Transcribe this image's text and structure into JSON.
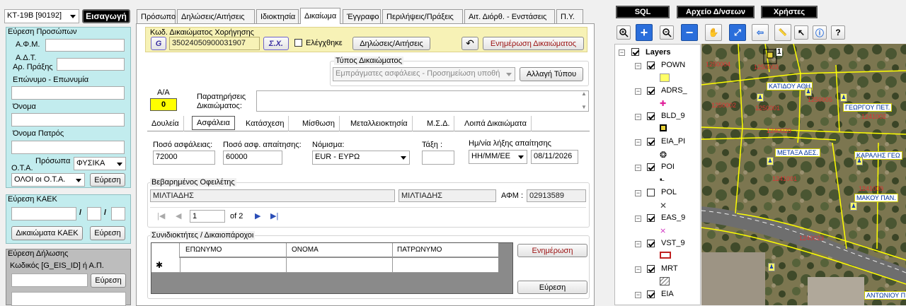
{
  "topbar": {
    "record_id": "ΚΤ-19Β  [90192]",
    "insert_label": "Εισαγωγή"
  },
  "search_persons": {
    "title": "Εύρεση Προσώπων",
    "afm_label": "Α.Φ.Μ.",
    "adt_label": "Α.Δ.Τ.",
    "praxis_label": "Αρ. Πράξης",
    "surname_label": "Επώνυμο - Επωνυμία",
    "name_label": "Όνομα",
    "father_label": "Όνομα Πατρός",
    "persons_label": "Πρόσωπα",
    "persons_value": "ΦΥΣΙΚΑ",
    "ota_label": "Ο.Τ.Α.",
    "ota_value": "ΟΛΟΙ οι Ο.Τ.Α.",
    "search_label": "Εύρεση"
  },
  "search_kaek": {
    "title": "Εύρεση ΚΑΕΚ",
    "slash": "/",
    "rights_label": "Δικαιώματα ΚΑΕΚ",
    "search_label": "Εύρεση"
  },
  "search_decl": {
    "title": "Εύρεση Δήλωσης",
    "code_label": "Κωδικός [G_EIS_ID]  ή  Α.Π.",
    "search_label": "Εύρεση"
  },
  "tabs": [
    {
      "label": "Πρόσωπο"
    },
    {
      "label": "Δηλώσεις/Αιτήσεις"
    },
    {
      "label": "Ιδιοκτησία"
    },
    {
      "label": "Δικαίωμα"
    },
    {
      "label": "Έγγραφο"
    },
    {
      "label": "Περιλήψεις/Πράξεις"
    },
    {
      "label": "Αιτ. Διόρθ. - Ενστάσεις"
    },
    {
      "label": "Π.Υ."
    }
  ],
  "right_header": {
    "code_label": "Κωδ. Δικαιώματος Χορήγησης",
    "g_label": "G",
    "code_value": "35024050900031907",
    "sx_label": "Σ.Χ.",
    "checked_label": "Ελέγχθηκε",
    "decl_label": "Δηλώσεις/Αιτήσεις",
    "update_label": "Ενημέρωση Δικαιώματος"
  },
  "right_type": {
    "title": "Τύπος Δικαιώματος",
    "value": "Εμπράγματες ασφάλειες - Προσημείωση υποθή",
    "change_label": "Αλλαγή Τύπου"
  },
  "aa": {
    "label": "Α/Α",
    "value": "0",
    "notes_label_1": "Παρατηρήσεις",
    "notes_label_2": "Δικαιώματος:"
  },
  "subtabs": [
    {
      "label": "Δουλεία"
    },
    {
      "label": "Ασφάλεια"
    },
    {
      "label": "Κατάσχεση"
    },
    {
      "label": "Μίσθωση"
    },
    {
      "label": "Μεταλλειοκτησία"
    },
    {
      "label": "Μ.Σ.Δ."
    },
    {
      "label": "Λοιπά Δικαιώματα"
    }
  ],
  "security": {
    "amount_label": "Ποσό ασφάλειας:",
    "amount_value": "72000",
    "claim_label": "Ποσό ασφ. απαίτησης:",
    "claim_value": "60000",
    "currency_label": "Νόμισμα:",
    "currency_value": "EUR - ΕΥΡΩ",
    "rank_label": "Τάξη :",
    "due_label": "Ημ/νία λήξης απαίτησης",
    "due_format": "ΗΗ/ΜΜ/ΕΕ",
    "due_value": "08/11/2026"
  },
  "debtor": {
    "title": "Βεβαρημένος Οφειλέτης",
    "surname": "ΜΙΛΤΙΑΔΗΣ",
    "name": "ΜΙΛΤΙΑΔΗΣ",
    "afm_label": "ΑΦΜ :",
    "afm_value": "02913589",
    "page": "1",
    "of_pages": "of 2"
  },
  "coowners": {
    "title": "Συνιδιοκτήτες / Δικαιοπάροχοι",
    "columns": [
      "ΕΠΩΝΥΜΟ",
      "ΟΝΟΜΑ",
      "ΠΑΤΡΩΝΥΜΟ"
    ],
    "new_row_marker": "✱",
    "update_label": "Ενημέρωση",
    "search_label": "Εύρεση"
  },
  "map_toolbar": {
    "sql_label": "SQL",
    "archive_label": "Αρχείο Δ/νσεων",
    "users_label": "Χρήστες",
    "help_label": "?"
  },
  "layers": {
    "title": "Layers",
    "items": [
      {
        "name": "POWN",
        "checked": true
      },
      {
        "name": "ADRS_",
        "checked": true
      },
      {
        "name": "BLD_9",
        "checked": true
      },
      {
        "name": "EIA_PI",
        "checked": true
      },
      {
        "name": "POI",
        "checked": true
      },
      {
        "name": "POL",
        "checked": false
      },
      {
        "name": "EAS_9",
        "checked": true
      },
      {
        "name": "VST_9",
        "checked": true
      },
      {
        "name": "MRT",
        "checked": true
      },
      {
        "name": "EIA",
        "checked": true
      }
    ]
  },
  "map": {
    "parcels": [
      "1250004",
      "1250003",
      "1250002",
      "1250001",
      "1250005",
      "1240029",
      "1241002",
      "1241001",
      "1241009",
      "1240023"
    ],
    "streets": [
      "ΚΑΤΙΔΟΥ ΑΘΗ",
      "ΓΕΩΡΓΟΥ ΠΕΤ.",
      "ΜΕΤΑΞΑ ΔΕΣ.",
      "ΚΑΡΑΛΗΣ ΓΕΩ",
      "ΜΑΚΟΥ ΠΑΝ.",
      "ΑΝΤΩΝΙΟΥ Π"
    ],
    "marker_label": "1"
  }
}
